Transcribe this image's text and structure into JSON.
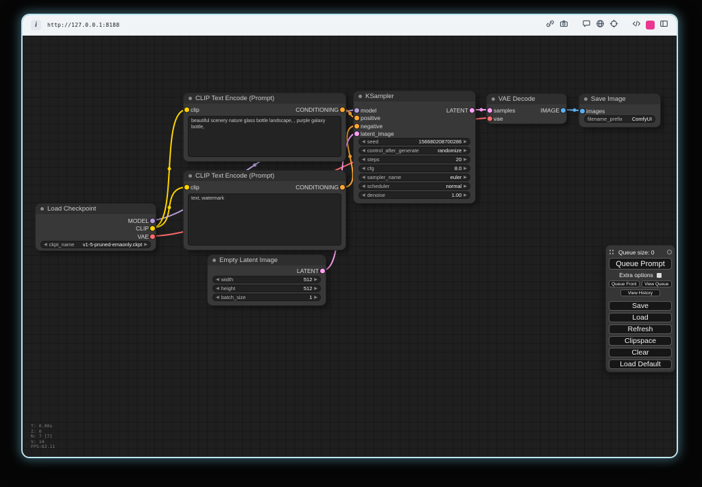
{
  "browser": {
    "url": "http://127.0.0.1:8188"
  },
  "icons": {
    "info": "i",
    "arrow_left": "◀",
    "arrow_right": "▶"
  },
  "colors": {
    "model": "#b39ddb",
    "clip": "#ffd400",
    "vae": "#ff6b6b",
    "conditioning": "#ffa931",
    "latent": "#ff9ff3",
    "image": "#5db0f0"
  },
  "nodes": {
    "load_checkpoint": {
      "title": "Load Checkpoint",
      "outputs": [
        "MODEL",
        "CLIP",
        "VAE"
      ],
      "ckpt_name": {
        "label": "ckpt_name",
        "value": "v1-5-pruned-emaonly.ckpt"
      }
    },
    "clip_positive": {
      "title": "CLIP Text Encode (Prompt)",
      "input": "clip",
      "output": "CONDITIONING",
      "text": "beautiful scenery nature glass bottle landscape, , purple galaxy bottle,"
    },
    "clip_negative": {
      "title": "CLIP Text Encode (Prompt)",
      "input": "clip",
      "output": "CONDITIONING",
      "text": "text, watermark"
    },
    "ksampler": {
      "title": "KSampler",
      "inputs": [
        "model",
        "positive",
        "negative",
        "latent_image"
      ],
      "output": "LATENT",
      "widgets": [
        {
          "label": "seed",
          "value": "156680208700286"
        },
        {
          "label": "control_after_generate",
          "value": "randomize"
        },
        {
          "label": "steps",
          "value": "20"
        },
        {
          "label": "cfg",
          "value": "8.0"
        },
        {
          "label": "sampler_name",
          "value": "euler"
        },
        {
          "label": "scheduler",
          "value": "normal"
        },
        {
          "label": "denoise",
          "value": "1.00"
        }
      ]
    },
    "empty_latent": {
      "title": "Empty Latent Image",
      "output": "LATENT",
      "widgets": [
        {
          "label": "width",
          "value": "512"
        },
        {
          "label": "height",
          "value": "512"
        },
        {
          "label": "batch_size",
          "value": "1"
        }
      ]
    },
    "vae_decode": {
      "title": "VAE Decode",
      "inputs": [
        "samples",
        "vae"
      ],
      "output": "IMAGE"
    },
    "save_image": {
      "title": "Save Image",
      "input": "images",
      "filename_prefix": {
        "label": "filename_prefix",
        "value": "ComfyUI"
      }
    }
  },
  "menu": {
    "queue_size": "Queue size: 0",
    "queue_prompt": "Queue Prompt",
    "extra_options": "Extra options",
    "queue_front": "Queue Front",
    "view_queue": "View Queue",
    "view_history": "View History",
    "actions": [
      "Save",
      "Load",
      "Refresh",
      "Clipspace",
      "Clear",
      "Load Default"
    ]
  },
  "stats": [
    "T: 0.00s",
    "I: 0",
    "N: 7 [7]",
    "V: 14",
    "FPS:62.11"
  ]
}
